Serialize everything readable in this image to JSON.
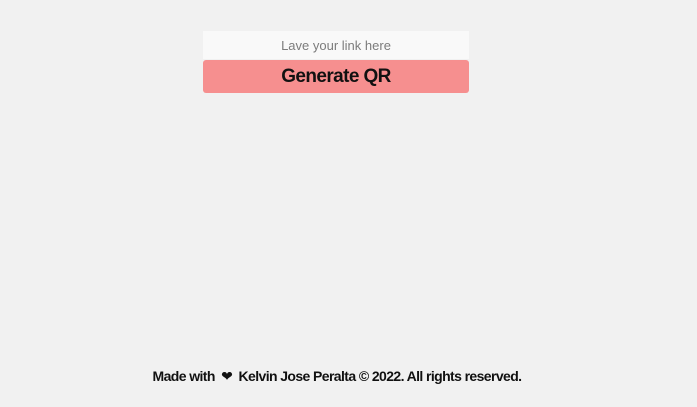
{
  "form": {
    "link_input": {
      "placeholder": "Lave your link here",
      "value": ""
    },
    "generate_button_label": "Generate QR"
  },
  "footer": {
    "made_with": "Made with",
    "heart_icon": "❤",
    "credit": "Kelvin Jose Peralta © 2022. All rights reserved."
  },
  "colors": {
    "background": "#f1f1f1",
    "input_background": "#f9f9f9",
    "button_background": "#f68f8f",
    "text": "#111111",
    "placeholder": "#7c7c7c"
  }
}
